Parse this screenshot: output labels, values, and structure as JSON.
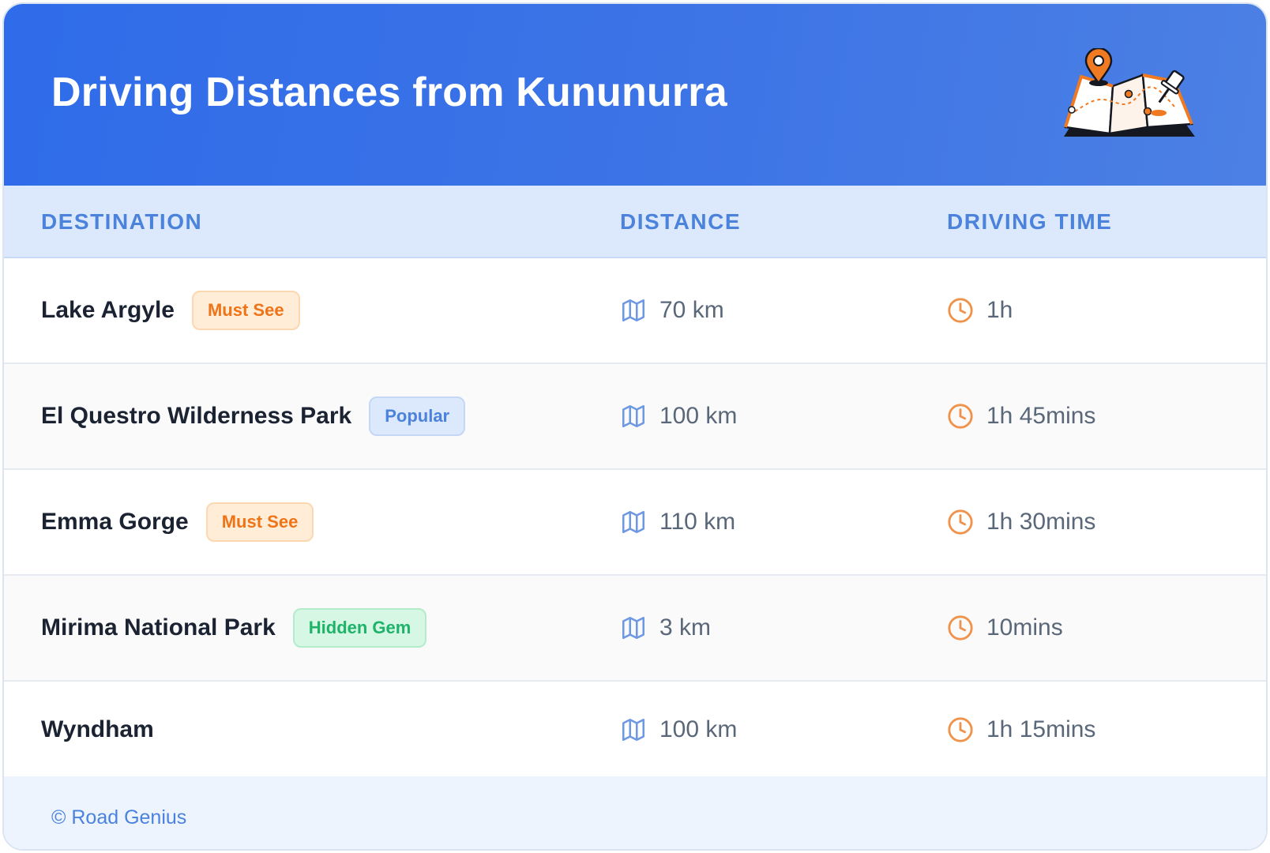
{
  "header": {
    "title": "Driving Distances from Kununurra",
    "illustration_icon": "folded-map-with-pins-icon"
  },
  "columns": {
    "destination": "DESTINATION",
    "distance": "DISTANCE",
    "driving_time": "DRIVING TIME"
  },
  "rows": [
    {
      "destination": "Lake Argyle",
      "badge": "Must See",
      "distance": "70 km",
      "time": "1h"
    },
    {
      "destination": "El Questro Wilderness Park",
      "badge": "Popular",
      "distance": "100 km",
      "time": "1h 45mins"
    },
    {
      "destination": "Emma Gorge",
      "badge": "Must See",
      "distance": "110 km",
      "time": "1h 30mins"
    },
    {
      "destination": "Mirima National Park",
      "badge": "Hidden Gem",
      "distance": "3 km",
      "time": "10mins"
    },
    {
      "destination": "Wyndham",
      "badge": "",
      "distance": "100 km",
      "time": "1h 15mins"
    }
  ],
  "icons": {
    "distance": "map-icon",
    "time": "clock-icon"
  },
  "footer": {
    "copyright": "© Road Genius"
  },
  "colors": {
    "header_gradient_start": "#2f6ce9",
    "header_gradient_end": "#4c80e4",
    "accent_blue": "#4a82dc",
    "must_see": "#ef7417",
    "popular": "#4a82dc",
    "hidden_gem": "#1fb36a",
    "clock_orange": "#f0924a"
  }
}
